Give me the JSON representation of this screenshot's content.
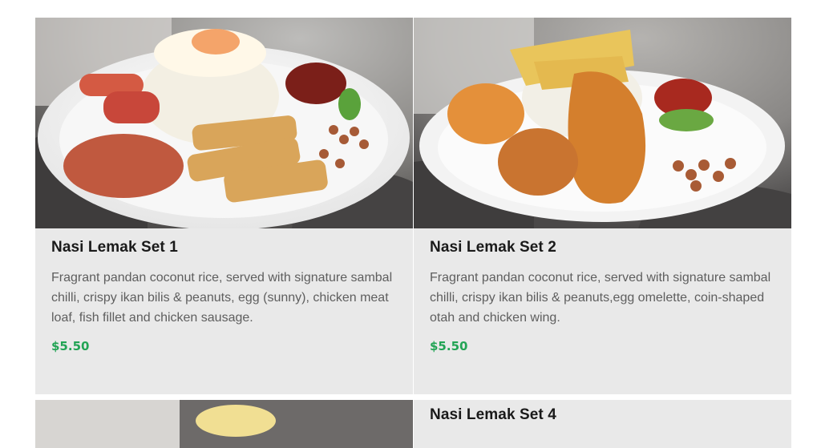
{
  "menu": {
    "items": [
      {
        "title": "Nasi Lemak Set 1",
        "description": "Fragrant pandan coconut rice, served with signature sambal chilli, crispy ikan bilis & peanuts, egg (sunny), chicken meat loaf, fish fillet and chicken sausage.",
        "price": "$5.50",
        "image_icon": "nasi-lemak-set-1-photo"
      },
      {
        "title": "Nasi Lemak Set 2",
        "description": "Fragrant pandan coconut rice, served with signature sambal chilli, crispy ikan bilis & peanuts,egg omelette, coin-shaped otah and chicken wing.",
        "price": "$5.50",
        "image_icon": "nasi-lemak-set-2-photo"
      },
      {
        "title": "",
        "image_icon": "nasi-lemak-set-3-photo"
      },
      {
        "title": "Nasi Lemak Set 4",
        "image_icon": ""
      }
    ]
  },
  "colors": {
    "card_background": "#e9e9e9",
    "price": "#23a455",
    "title": "#1a1a1a",
    "description": "#5e5e5e"
  }
}
